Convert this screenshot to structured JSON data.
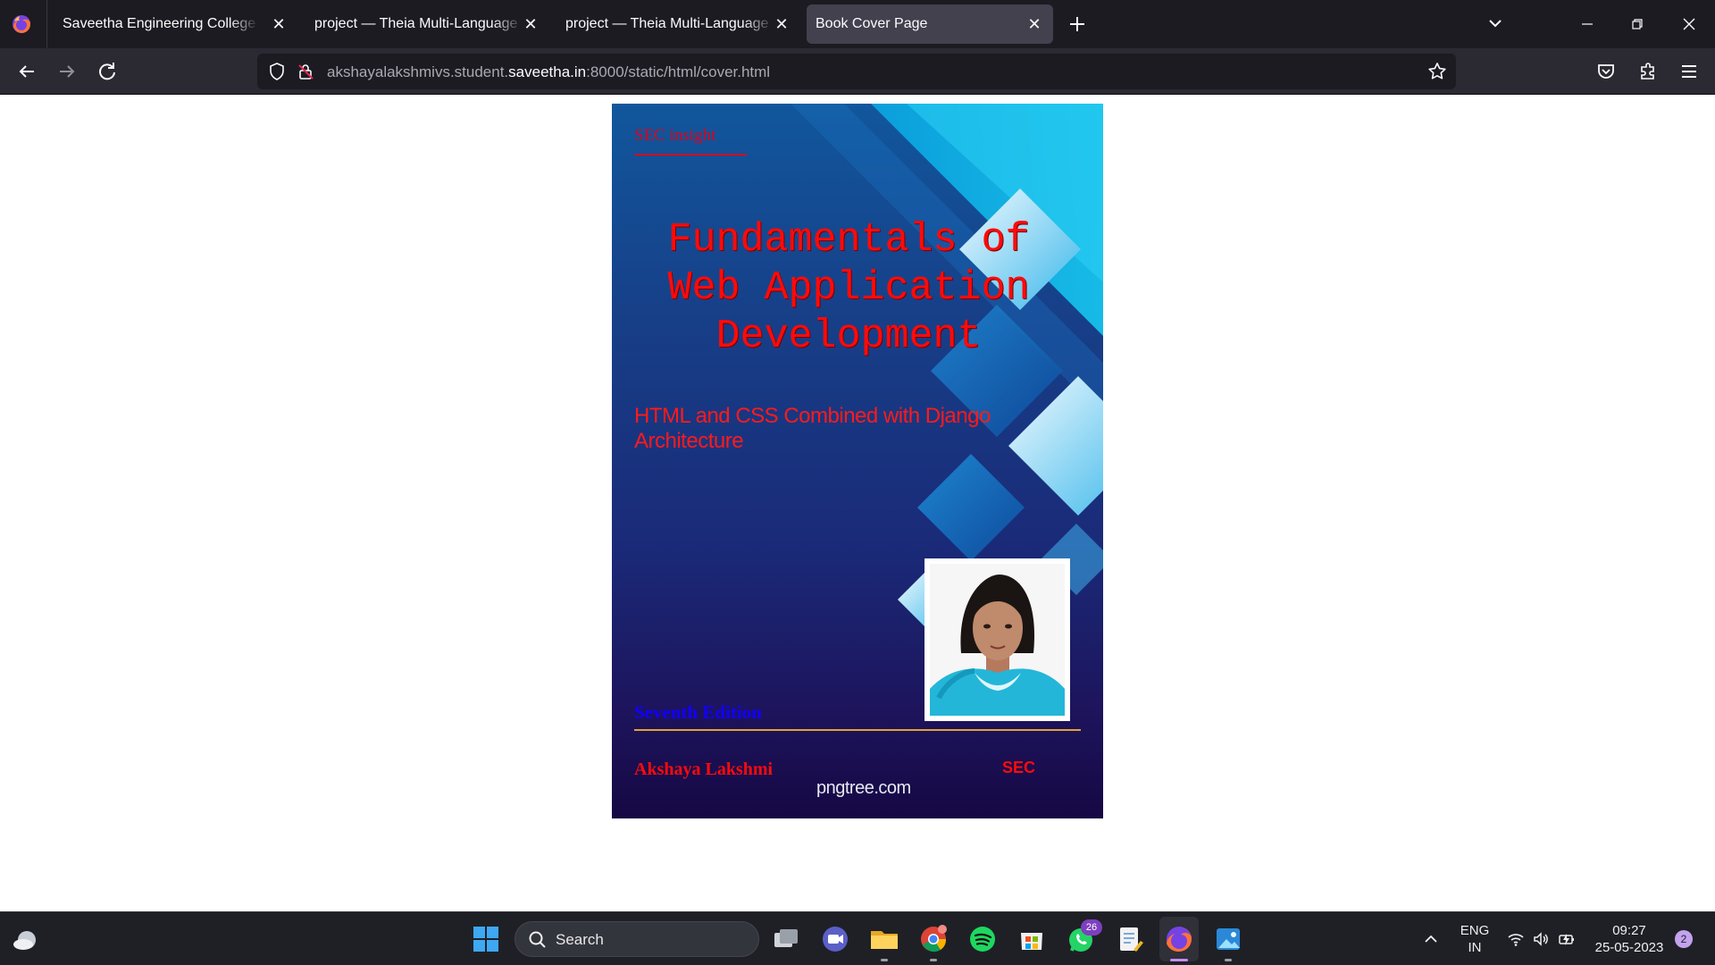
{
  "browser": {
    "tabs": [
      {
        "title": "Saveetha Engineering College",
        "active": false
      },
      {
        "title": "project — Theia Multi-Language Explorer",
        "active": false
      },
      {
        "title": "project — Theia Multi-Language Explorer",
        "active": false
      },
      {
        "title": "Book Cover Page",
        "active": true
      }
    ],
    "url": {
      "prefix": "akshayalakshmivs.student.",
      "host": "saveetha.in",
      "suffix": ":8000/static/html/cover.html"
    }
  },
  "cover": {
    "series_label": "SEC insight",
    "title": "Fundamentals of Web Application Development",
    "subtitle": "HTML and CSS Combined with Django Architecture",
    "edition": "Seventh Edition",
    "author": "Akshaya Lakshmi",
    "publisher": "SEC",
    "watermark": "pngtree.com"
  },
  "taskbar": {
    "search_label": "Search",
    "whatsapp_badge": "26",
    "language": {
      "line1": "ENG",
      "line2": "IN"
    },
    "time": "09:27",
    "date": "25-05-2023",
    "notification_count": "2"
  },
  "colors": {
    "title_red": "#ff0a0a",
    "edition_blue": "#1200ff",
    "rule_gold": "#e3a13a"
  }
}
